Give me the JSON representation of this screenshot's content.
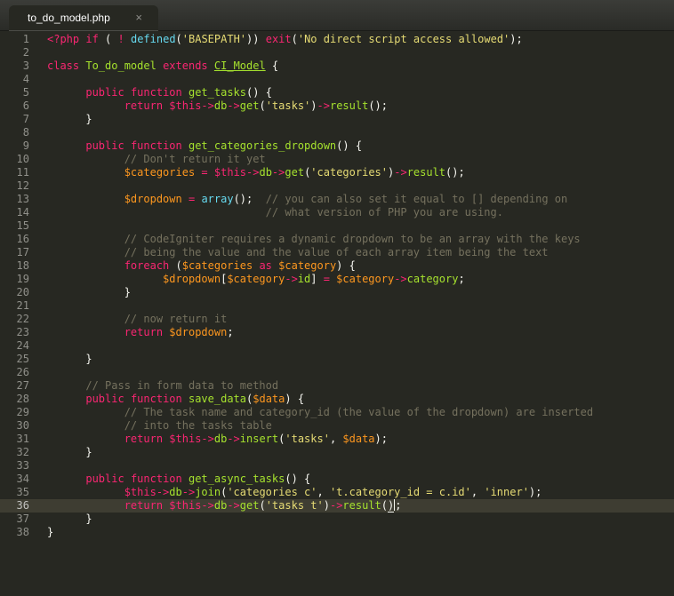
{
  "tab": {
    "title": "to_do_model.php",
    "close_icon": "×"
  },
  "code": {
    "active_line": 36,
    "lines": [
      "<?php if ( ! defined('BASEPATH')) exit('No direct script access allowed');",
      "",
      "class To_do_model extends CI_Model {",
      "",
      "      public function get_tasks() {",
      "            return $this->db->get('tasks')->result();",
      "      }",
      "",
      "      public function get_categories_dropdown() {",
      "            // Don't return it yet",
      "            $categories = $this->db->get('categories')->result();",
      "",
      "            $dropdown = array();  // you can also set it equal to [] depending on",
      "                                  // what version of PHP you are using.",
      "",
      "            // CodeIgniter requires a dynamic dropdown to be an array with the keys",
      "            // being the value and the value of each array item being the text",
      "            foreach ($categories as $category) {",
      "                  $dropdown[$category->id] = $category->category;",
      "            }",
      "",
      "            // now return it",
      "            return $dropdown;",
      "",
      "      }",
      "",
      "      // Pass in form data to method",
      "      public function save_data($data) {",
      "            // The task name and category_id (the value of the dropdown) are inserted",
      "            // into the tasks table",
      "            return $this->db->insert('tasks', $data);",
      "      }",
      "",
      "      public function get_async_tasks() {",
      "            $this->db->join('categories c', 't.category_id = c.id', 'inner');",
      "            return $this->db->get('tasks t')->result();",
      "      }",
      "}"
    ]
  }
}
